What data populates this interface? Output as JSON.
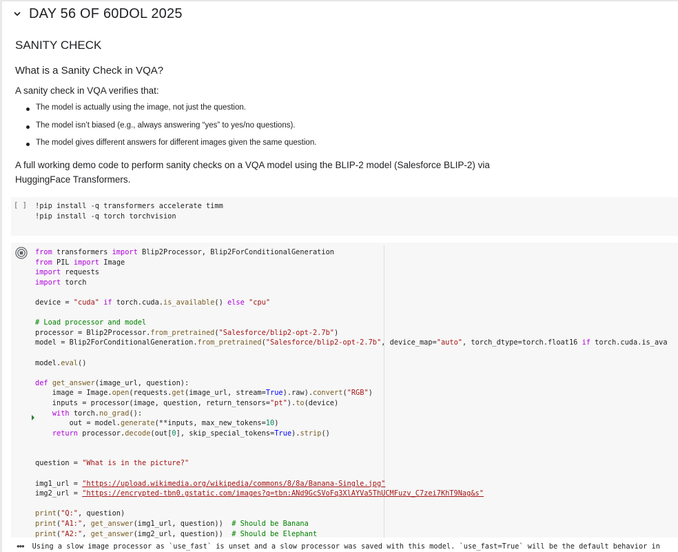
{
  "section": {
    "title": "DAY 56 OF 60DOL 2025",
    "icon": "chevron-down-icon"
  },
  "markdown": {
    "heading1": "SANITY CHECK",
    "heading2": "What is a Sanity Check in VQA?",
    "intro": "A sanity check in VQA verifies that:",
    "bullets": [
      "The model is actually using the image, not just the question.",
      "The model isn’t biased (e.g., always answering “yes” to yes/no questions).",
      "The model gives different answers for different images given the same question."
    ],
    "demo_line1": "A full working demo code to perform sanity checks on a VQA model using the BLIP-2 model (Salesforce BLIP-2) via",
    "demo_line2": "HuggingFace Transformers."
  },
  "cell1": {
    "exec_label": "[ ]",
    "lines": [
      "!pip install -q transformers accelerate timm",
      "!pip install -q torch torchvision"
    ]
  },
  "cell2": {
    "run_icon": "stop-circle-icon",
    "lines": [
      "from transformers import Blip2Processor, Blip2ForConditionalGeneration",
      "from PIL import Image",
      "import requests",
      "import torch",
      "",
      "device = \"cuda\" if torch.cuda.is_available() else \"cpu\"",
      "",
      "# Load processor and model",
      "processor = Blip2Processor.from_pretrained(\"Salesforce/blip2-opt-2.7b\")",
      "model = Blip2ForConditionalGeneration.from_pretrained(\"Salesforce/blip2-opt-2.7b\", device_map=\"auto\", torch_dtype=torch.float16 if torch.cuda.is_ava",
      "",
      "model.eval()",
      "",
      "def get_answer(image_url, question):",
      "    image = Image.open(requests.get(image_url, stream=True).raw).convert(\"RGB\")",
      "    inputs = processor(image, question, return_tensors=\"pt\").to(device)",
      "    with torch.no_grad():",
      "        out = model.generate(**inputs, max_new_tokens=10)",
      "    return processor.decode(out[0], skip_special_tokens=True).strip()",
      "",
      "",
      "question = \"What is in the picture?\"",
      "",
      "img1_url = \"https://upload.wikimedia.org/wikipedia/commons/8/8a/Banana-Single.jpg\"",
      "img2_url = \"https://encrypted-tbn0.gstatic.com/images?q=tbn:ANd9GcSVoFq3XlAYVa5ThUCMFuzv_C7zei7KhT9Nag&s\"",
      "",
      "print(\"Q:\", question)",
      "print(\"A1:\", get_answer(img1_url, question))  # Should be Banana",
      "print(\"A2:\", get_answer(img2_url, question))  # Should be Elephant"
    ]
  },
  "output": {
    "icon": "more-horizontal-icon",
    "text": "Using a slow image processor as `use_fast` is unset and a slow processor was saved with this model. `use_fast=True` will be the default behavior in"
  }
}
